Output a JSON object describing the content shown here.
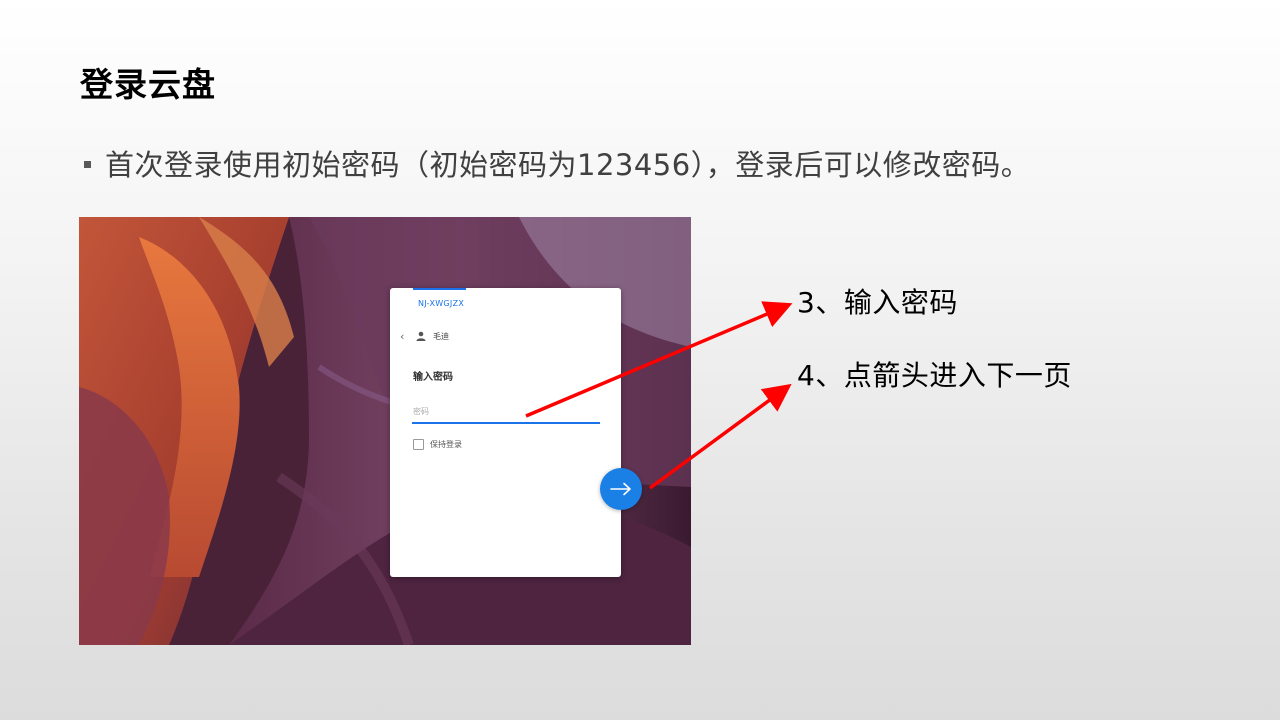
{
  "slide": {
    "title": "登录云盘",
    "bullet": "首次登录使用初始密码（初始密码为123456），登录后可以修改密码。"
  },
  "login_card": {
    "tab_label": "NJ-XWGJZX",
    "user_name": "毛迪",
    "heading": "输入密码",
    "password_placeholder": "密码",
    "password_value": "",
    "keep_login_label": "保持登录",
    "keep_login_checked": false,
    "next_icon": "arrow-right-icon",
    "back_icon": "chevron-left-icon",
    "user_icon": "person-icon"
  },
  "annotations": {
    "step3": "3、输入密码",
    "step4": "4、点箭头进入下一页"
  },
  "colors": {
    "accent_blue": "#1a73e8",
    "button_blue": "#1a80e6",
    "arrow_red": "#ff0000",
    "title_black": "#000000",
    "bullet_gray": "#404040"
  }
}
